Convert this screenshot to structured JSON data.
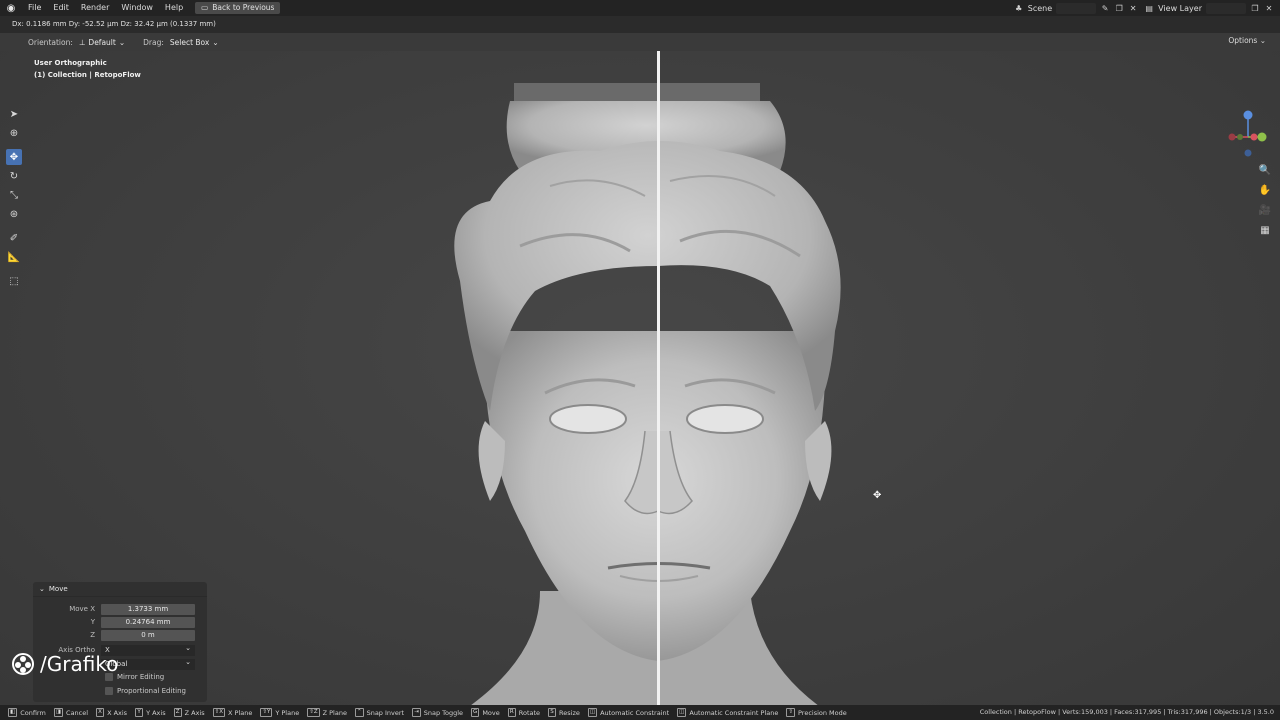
{
  "menu": {
    "items": [
      "File",
      "Edit",
      "Render",
      "Window",
      "Help"
    ],
    "back_button": "Back to Previous",
    "scene_label": "Scene",
    "view_layer_label": "View Layer"
  },
  "header": {
    "transform_readout": "Dx: 0.1186 mm   Dy: -52.52 µm   Dz: 32.42 µm (0.1337 mm)"
  },
  "tool_settings": {
    "orientation_label": "Orientation:",
    "orientation_value": "Default",
    "drag_label": "Drag:",
    "drag_value": "Select Box",
    "options_label": "Options"
  },
  "viewport": {
    "view_name": "User Orthographic",
    "collection": "(1) Collection | RetopoFlow"
  },
  "operator_panel": {
    "title": "Move",
    "move_x_label": "Move X",
    "move_x_value": "1.3733 mm",
    "y_label": "Y",
    "y_value": "0.24764 mm",
    "z_label": "Z",
    "z_value": "0 m",
    "axis_ortho_label": "Axis Ortho",
    "axis_ortho_value": "X",
    "orientation_value": "Global",
    "mirror_editing": "Mirror Editing",
    "proportional_editing": "Proportional Editing"
  },
  "watermark": {
    "text": "/Grafiko"
  },
  "statusbar": {
    "items": [
      {
        "key": "",
        "label": "Confirm"
      },
      {
        "key": "",
        "label": "Cancel"
      },
      {
        "key": "X",
        "label": "X Axis"
      },
      {
        "key": "Y",
        "label": "Y Axis"
      },
      {
        "key": "Z",
        "label": "Z Axis"
      },
      {
        "key": "⇧X",
        "label": "X Plane"
      },
      {
        "key": "⇧Y",
        "label": "Y Plane"
      },
      {
        "key": "⇧Z",
        "label": "Z Plane"
      },
      {
        "key": "",
        "label": "Snap Invert"
      },
      {
        "key": "",
        "label": "Snap Toggle"
      },
      {
        "key": "G",
        "label": "Move"
      },
      {
        "key": "R",
        "label": "Rotate"
      },
      {
        "key": "S",
        "label": "Resize"
      },
      {
        "key": "",
        "label": "Automatic Constraint"
      },
      {
        "key": "",
        "label": "Automatic Constraint Plane"
      },
      {
        "key": "⇧",
        "label": "Precision Mode"
      }
    ],
    "stats": "Collection | RetopoFlow | Verts:159,003 | Faces:317,995 | Tris:317,996 | Objects:1/3 | 3.5.0"
  }
}
